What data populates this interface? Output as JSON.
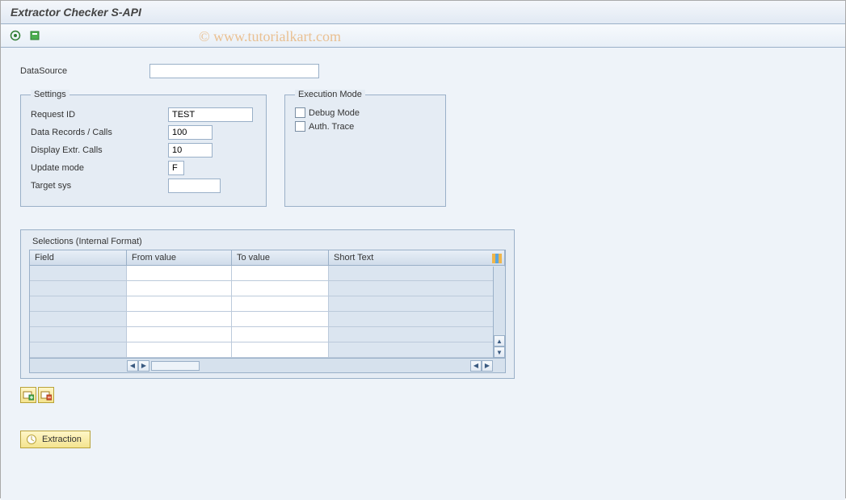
{
  "title": "Extractor Checker S-API",
  "watermark": "© www.tutorialkart.com",
  "datasource": {
    "label": "DataSource",
    "value": ""
  },
  "settings": {
    "legend": "Settings",
    "request_id": {
      "label": "Request ID",
      "value": "TEST"
    },
    "data_records": {
      "label": "Data Records / Calls",
      "value": "100"
    },
    "display_extr": {
      "label": "Display Extr. Calls",
      "value": "10"
    },
    "update_mode": {
      "label": "Update mode",
      "value": "F"
    },
    "target_sys": {
      "label": "Target sys",
      "value": ""
    }
  },
  "exec_mode": {
    "legend": "Execution Mode",
    "debug": {
      "label": "Debug Mode",
      "checked": false
    },
    "auth": {
      "label": "Auth. Trace",
      "checked": false
    }
  },
  "selections": {
    "title": "Selections (Internal Format)",
    "columns": {
      "field": "Field",
      "from": "From value",
      "to": "To value",
      "short": "Short Text"
    },
    "rows": [
      {
        "field": "",
        "from": "",
        "to": "",
        "short": ""
      },
      {
        "field": "",
        "from": "",
        "to": "",
        "short": ""
      },
      {
        "field": "",
        "from": "",
        "to": "",
        "short": ""
      },
      {
        "field": "",
        "from": "",
        "to": "",
        "short": ""
      },
      {
        "field": "",
        "from": "",
        "to": "",
        "short": ""
      },
      {
        "field": "",
        "from": "",
        "to": "",
        "short": ""
      }
    ]
  },
  "buttons": {
    "extraction": "Extraction"
  }
}
